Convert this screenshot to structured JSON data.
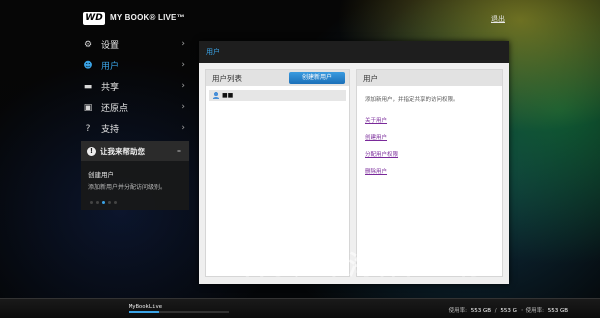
{
  "header": {
    "logo_text": "WD",
    "product_name": "MY BOOK® LIVE™",
    "logout_label": "退出"
  },
  "sidebar": {
    "items": [
      {
        "label": "设置",
        "icon": "gear-icon",
        "glyph": "⚙"
      },
      {
        "label": "用户",
        "icon": "user-icon",
        "glyph": "☻"
      },
      {
        "label": "共享",
        "icon": "folder-icon",
        "glyph": "▬"
      },
      {
        "label": "还原点",
        "icon": "restore-icon",
        "glyph": "▣"
      },
      {
        "label": "支持",
        "icon": "help-icon",
        "glyph": "?"
      }
    ],
    "active_index": 1
  },
  "help_panel": {
    "title": "让我来帮助您",
    "topic": "创建用户",
    "text": "添加新用户并分配访问级别。"
  },
  "main": {
    "section_title": "用户",
    "user_list": {
      "header": "用户列表",
      "create_button": "创建新用户",
      "users": [
        "■■"
      ]
    },
    "user_panel": {
      "header": "用户",
      "description": "添加新用户，并指定共享的访问权限。",
      "links": [
        "关于用户",
        "创建用户",
        "分配用户权限",
        "删除用户"
      ]
    }
  },
  "watermark": "石家庄市海森化工有",
  "status_bar": {
    "device_name": "MyBookLive",
    "used_fraction": 0.3,
    "free_label": "使用率:",
    "free_value": "553 GB",
    "total_value": "553 G",
    "used_label": "使用率:",
    "used_value": "553 GB"
  },
  "colors": {
    "accent": "#3aa3e6",
    "link": "#7a2a9a"
  }
}
